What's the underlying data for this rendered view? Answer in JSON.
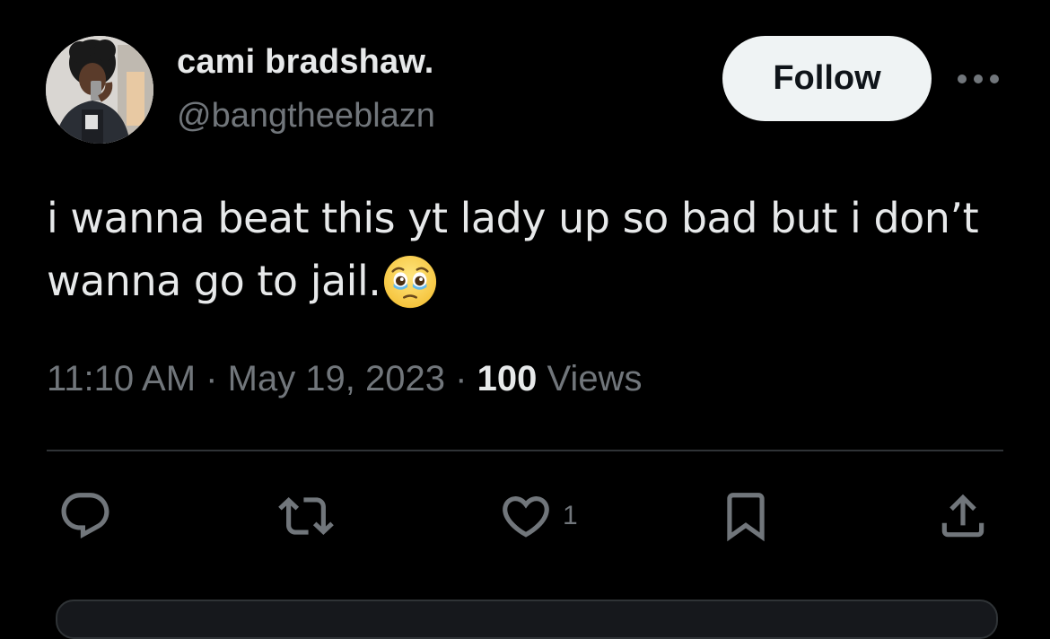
{
  "author": {
    "display_name": "cami bradshaw.",
    "handle": "@bangtheeblazn",
    "avatar_icon": "profile-photo"
  },
  "follow_button": {
    "label": "Follow"
  },
  "more_button": {
    "icon": "more-horizontal-icon"
  },
  "tweet": {
    "text": "i wanna beat this yt lady up so bad but i don’t wanna go to jail.",
    "emoji": "face-holding-back-tears"
  },
  "meta": {
    "time": "11:10 AM",
    "separator": "·",
    "date": "May 19, 2023",
    "views_count": "100",
    "views_label": "Views"
  },
  "actions": {
    "reply_icon": "reply-icon",
    "retweet_icon": "retweet-icon",
    "like_icon": "heart-icon",
    "like_count": "1",
    "bookmark_icon": "bookmark-icon",
    "share_icon": "share-icon"
  },
  "colors": {
    "background": "#000000",
    "primary_text": "#e7e9ea",
    "secondary_text": "#71767b",
    "divider": "#2f3336",
    "follow_bg": "#eff3f4"
  }
}
